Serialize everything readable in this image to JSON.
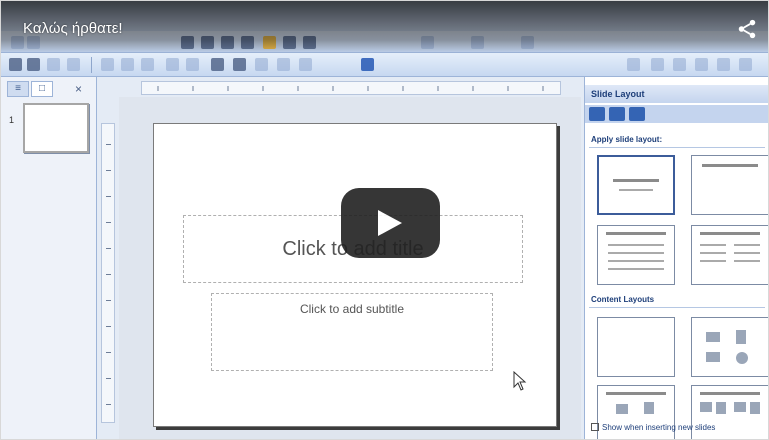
{
  "video": {
    "title": "Καλώς ήρθατε!",
    "icons": {
      "share": "share-icon",
      "play": "play-icon"
    }
  },
  "app": {
    "slide": {
      "number": "1",
      "title_placeholder": "Click to add title",
      "subtitle_placeholder": "Click to add subtitle"
    },
    "left_pane": {
      "tab_outline": "≡",
      "tab_slides": "□",
      "close": "×"
    },
    "task_pane": {
      "title": "Slide Layout",
      "apply_label": "Apply slide layout:",
      "content_layouts_label": "Content Layouts",
      "footer_checkbox": "Show when inserting new slides"
    }
  }
}
